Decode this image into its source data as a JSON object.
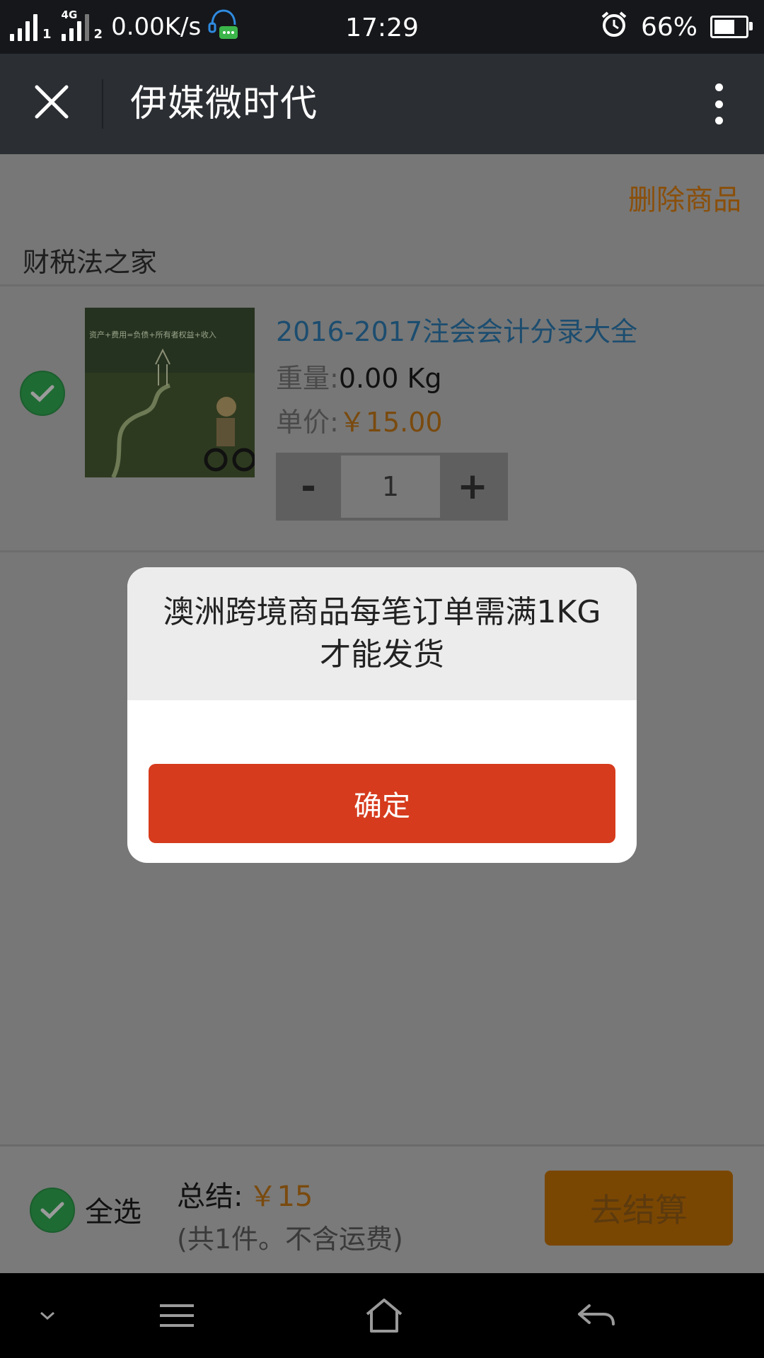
{
  "status_bar": {
    "network_type": "4G",
    "sim1": "1",
    "sim2": "2",
    "net_speed": "0.00K/s",
    "time": "17:29",
    "battery": "66%",
    "battery_level": 0.66
  },
  "header": {
    "title": "伊媒微时代"
  },
  "cart": {
    "delete_label": "删除商品",
    "shop_name": "财税法之家",
    "item": {
      "title": "2016-2017注会会计分录大全",
      "weight_label": "重量:",
      "weight_value": "0.00 Kg",
      "price_label": "单价:",
      "price_value": "￥15.00",
      "minus_label": "-",
      "quantity": "1",
      "plus_label": "+",
      "thumb_caption": "资产+费用=负债+所有者权益+收入"
    }
  },
  "footer": {
    "select_all_label": "全选",
    "total_label": "总结:",
    "total_amount": "￥15",
    "total_note": "(共1件。不含运费)",
    "checkout_label": "去结算"
  },
  "dialog": {
    "message": "澳洲跨境商品每笔订单需满1KG才能发货",
    "confirm_label": "确定"
  },
  "colors": {
    "accent_orange": "#e08a1a",
    "confirm_red": "#d63b1d",
    "check_green": "#2fa14c",
    "title_blue": "#2a7ab0"
  }
}
